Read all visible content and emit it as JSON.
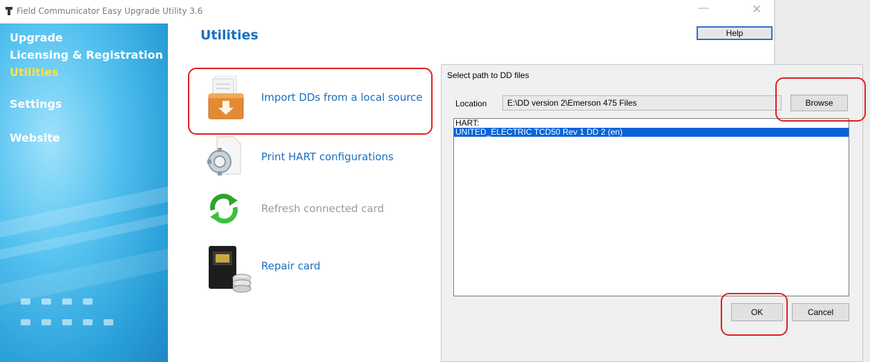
{
  "window": {
    "title": "Field Communicator Easy Upgrade Utility 3.6",
    "minimize_glyph": "—",
    "close_glyph": "✕"
  },
  "sidebar": {
    "items": [
      {
        "label": "Upgrade",
        "active": false
      },
      {
        "label": "Licensing & Registration",
        "active": false
      },
      {
        "label": "Utilities",
        "active": true
      },
      {
        "label": "Settings",
        "active": false
      },
      {
        "label": "Website",
        "active": false
      }
    ],
    "active_color": "#ffe14a"
  },
  "main": {
    "title": "Utilities",
    "help_label": "Help",
    "utilities": [
      {
        "label": "Import DDs from a local source",
        "icon": "import-folder-icon",
        "enabled": true,
        "highlighted": true
      },
      {
        "label": "Print HART configurations",
        "icon": "gear-document-icon",
        "enabled": true,
        "highlighted": false
      },
      {
        "label": "Refresh connected card",
        "icon": "refresh-arrows-icon",
        "enabled": false,
        "highlighted": false
      },
      {
        "label": "Repair card",
        "icon": "card-database-icon",
        "enabled": true,
        "highlighted": false
      }
    ]
  },
  "dialog": {
    "title": "Select path to DD files",
    "location_label": "Location",
    "location_value": "E:\\DD version 2\\Emerson 475 Files",
    "browse_label": "Browse",
    "list_items": [
      {
        "text": "HART:",
        "selected": false
      },
      {
        "text": "UNITED_ELECTRIC TCD50 Rev 1 DD 2 (en)",
        "selected": true
      }
    ],
    "ok_label": "OK",
    "cancel_label": "Cancel"
  },
  "colors": {
    "link_blue": "#1a6fbd",
    "highlight_red": "#e01e1e",
    "selection_blue": "#0a64d8"
  }
}
